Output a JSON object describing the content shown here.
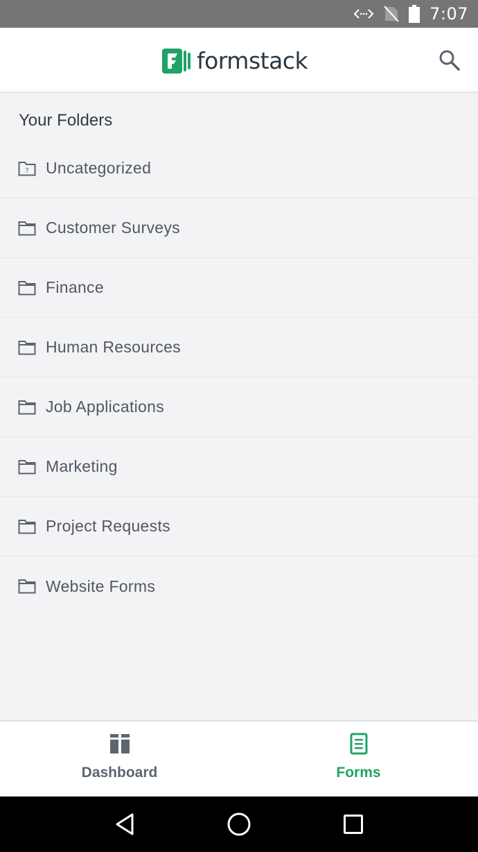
{
  "status_bar": {
    "time": "7:07",
    "icons": [
      "data-sync-icon",
      "no-sim-icon",
      "battery-icon"
    ]
  },
  "header": {
    "brand": "formstack",
    "brand_color": "#21a366",
    "search_icon": "search-icon"
  },
  "folders": {
    "title": "Your Folders",
    "items": [
      {
        "label": "Uncategorized",
        "icon": "folder-unknown-icon"
      },
      {
        "label": "Customer Surveys",
        "icon": "folder-icon"
      },
      {
        "label": "Finance",
        "icon": "folder-icon"
      },
      {
        "label": "Human Resources",
        "icon": "folder-icon"
      },
      {
        "label": "Job Applications",
        "icon": "folder-icon"
      },
      {
        "label": "Marketing",
        "icon": "folder-icon"
      },
      {
        "label": "Project Requests",
        "icon": "folder-icon"
      },
      {
        "label": "Website Forms",
        "icon": "folder-icon"
      }
    ]
  },
  "bottom_nav": {
    "tabs": [
      {
        "label": "Dashboard",
        "icon": "dashboard-icon",
        "active": false
      },
      {
        "label": "Forms",
        "icon": "forms-icon",
        "active": true
      }
    ],
    "active_color": "#20a464",
    "inactive_color": "#5d6670"
  },
  "system_nav": {
    "buttons": [
      "back-icon",
      "home-icon",
      "recents-icon"
    ]
  }
}
